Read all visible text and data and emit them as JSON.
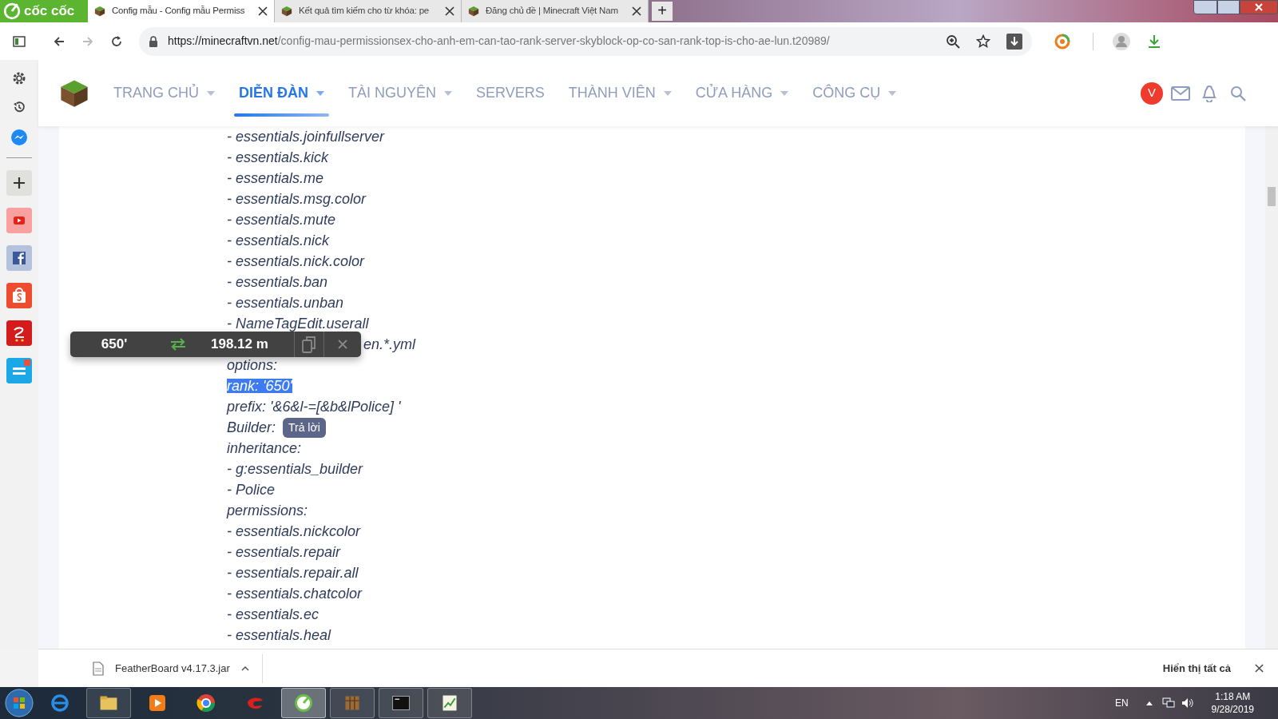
{
  "browser": {
    "logo": "cốc cốc",
    "tabs": [
      {
        "title": "Config mẫu - Config mẫu Permiss",
        "selected": true
      },
      {
        "title": "Kết quả tìm kiếm cho từ khóa: pe",
        "selected": false
      },
      {
        "title": "Đăng chủ đề | Minecraft Việt Nam",
        "selected": false
      }
    ],
    "new_tab": "+",
    "url": {
      "host": "https://minecraftvn.net",
      "path": "/config-mau-permissionsex-cho-anh-em-can-tao-rank-server-skyblock-op-co-san-rank-top-is-cho-ae-lun.t20989/"
    }
  },
  "site_nav": {
    "items": [
      {
        "label": "TRANG CHỦ",
        "selected": false,
        "dropdown": true
      },
      {
        "label": "DIỄN ĐÀN",
        "selected": true,
        "dropdown": true
      },
      {
        "label": "TÀI NGUYÊN",
        "selected": false,
        "dropdown": true
      },
      {
        "label": "SERVERS",
        "selected": false,
        "dropdown": false
      },
      {
        "label": "THÀNH VIÊN",
        "selected": false,
        "dropdown": true
      },
      {
        "label": "CỬA HÀNG",
        "selected": false,
        "dropdown": true
      },
      {
        "label": "CÔNG CỤ",
        "selected": false,
        "dropdown": true
      }
    ],
    "avatar": "V"
  },
  "content_lines": [
    {
      "text": "- essentials.joinfullserver",
      "selected": false,
      "kind": "line"
    },
    {
      "text": "- essentials.kick",
      "selected": false,
      "kind": "line"
    },
    {
      "text": "- essentials.me",
      "selected": false,
      "kind": "line"
    },
    {
      "text": "- essentials.msg.color",
      "selected": false,
      "kind": "line"
    },
    {
      "text": "- essentials.mute",
      "selected": false,
      "kind": "line"
    },
    {
      "text": "- essentials.nick",
      "selected": false,
      "kind": "line"
    },
    {
      "text": "- essentials.nick.color",
      "selected": false,
      "kind": "line"
    },
    {
      "text": "- essentials.ban",
      "selected": false,
      "kind": "line"
    },
    {
      "text": "- essentials.unban",
      "selected": false,
      "kind": "line"
    },
    {
      "text": "- NameTagEdit.userall",
      "selected": false,
      "kind": "line"
    },
    {
      "text": "en.*.yml",
      "selected": false,
      "kind": "covered"
    },
    {
      "text": "options:",
      "selected": false,
      "kind": "line"
    },
    {
      "text": "rank: '650'",
      "selected": true,
      "kind": "line"
    },
    {
      "text": "prefix: '&6&l-=[&b&lPolice] '",
      "selected": false,
      "kind": "line"
    },
    {
      "text": "Builder:",
      "selected": false,
      "kind": "line"
    },
    {
      "text": "inheritance:",
      "selected": false,
      "kind": "line"
    },
    {
      "text": "- g:essentials_builder",
      "selected": false,
      "kind": "line"
    },
    {
      "text": "- Police",
      "selected": false,
      "kind": "line"
    },
    {
      "text": "permissions:",
      "selected": false,
      "kind": "line"
    },
    {
      "text": "- essentials.nickcolor",
      "selected": false,
      "kind": "line"
    },
    {
      "text": "- essentials.repair",
      "selected": false,
      "kind": "line"
    },
    {
      "text": "- essentials.repair.all",
      "selected": false,
      "kind": "line"
    },
    {
      "text": "- essentials.chatcolor",
      "selected": false,
      "kind": "line"
    },
    {
      "text": "- essentials.ec",
      "selected": false,
      "kind": "line"
    },
    {
      "text": "- essentials.heal",
      "selected": false,
      "kind": "line"
    }
  ],
  "converter": {
    "from": "650'",
    "to": "198.12 m"
  },
  "tooltip": "Trả lời",
  "download_bar": {
    "file": "FeatherBoard v4.17.3.jar",
    "show_all": "Hiển thị tất cả"
  },
  "taskbar": {
    "language": "EN",
    "time": "1:18 AM",
    "date": "9/28/2019"
  }
}
